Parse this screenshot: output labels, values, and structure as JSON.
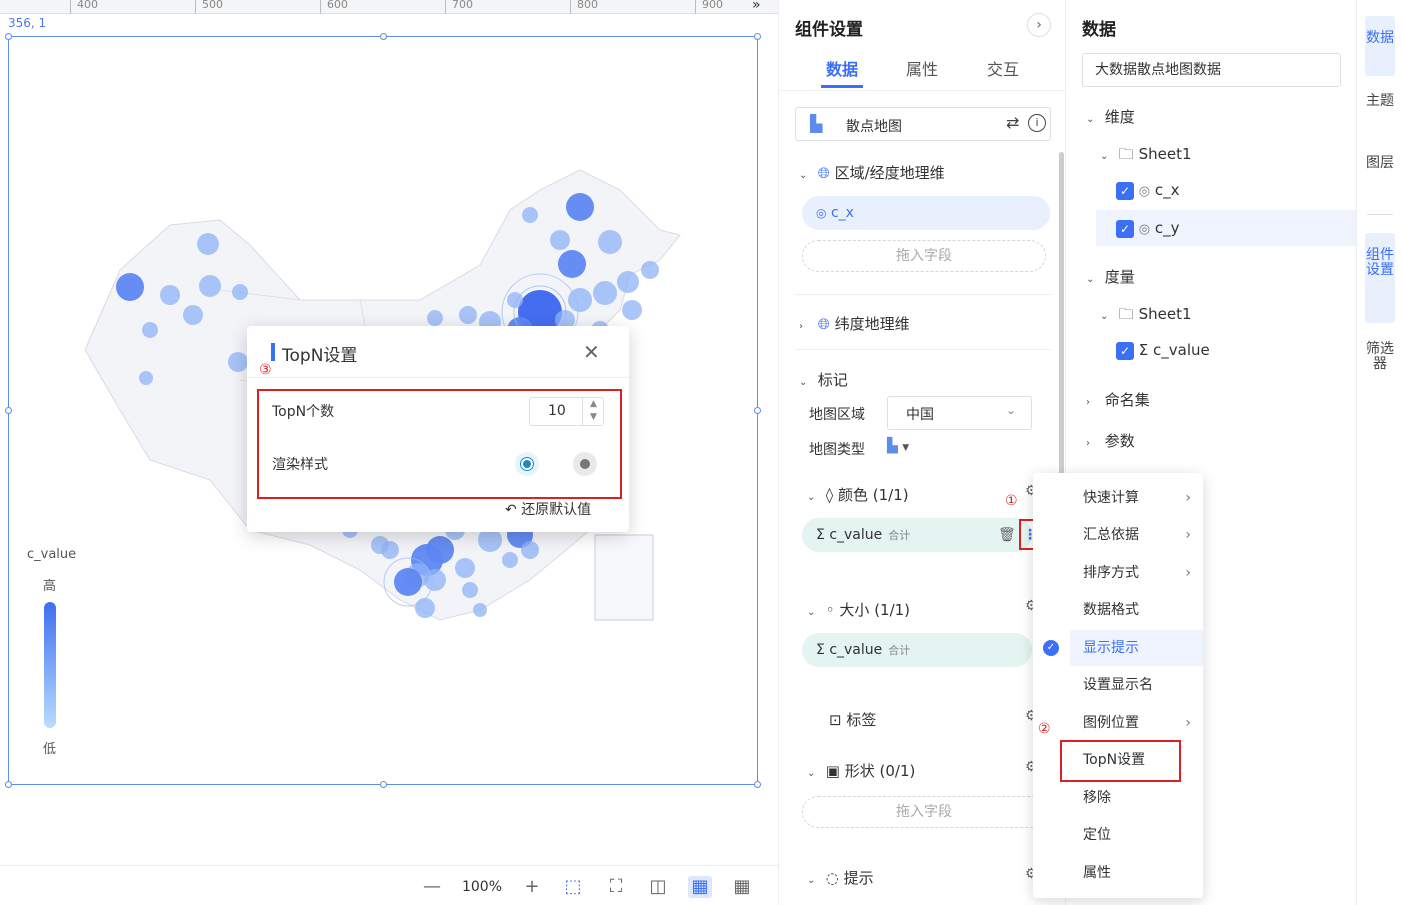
{
  "canvas": {
    "ruler_ticks": [
      "400",
      "500",
      "600",
      "700",
      "800",
      "900"
    ],
    "coord": "356, 1",
    "legend": {
      "title": "c_value",
      "high": "高",
      "low": "低"
    },
    "zoom": {
      "minus": "—",
      "level": "100%",
      "plus": "+"
    }
  },
  "dialog": {
    "title": "TopN设置",
    "annotation": "③",
    "topn_label": "TopN个数",
    "topn_value": "10",
    "render_label": "渲染样式",
    "reset_label": "还原默认值"
  },
  "component_panel": {
    "title": "组件设置",
    "tabs": [
      "数据",
      "属性",
      "交互"
    ],
    "chart_type": "散点地图",
    "region_section": "区域/经度地理维",
    "region_field": "c_x",
    "drop_placeholder": "拖入字段",
    "lat_section": "纬度地理维",
    "mark_section": "标记",
    "map_region_label": "地图区域",
    "map_region_value": "中国",
    "map_type_label": "地图类型",
    "color_section": "颜色 (1/1)",
    "color_field": "c_value",
    "agg_label": "合计",
    "size_section": "大小 (1/1)",
    "size_field": "c_value",
    "label_section": "标签",
    "shape_section": "形状 (0/1)",
    "tooltip_section": "提示",
    "annotation_1": "①",
    "annotation_2": "②"
  },
  "context_menu": {
    "items": [
      {
        "label": "快速计算",
        "submenu": true
      },
      {
        "label": "汇总依据",
        "submenu": true
      },
      {
        "label": "排序方式",
        "submenu": true
      },
      {
        "label": "数据格式",
        "submenu": false
      },
      {
        "label": "显示提示",
        "submenu": false,
        "checked": true
      },
      {
        "label": "设置显示名",
        "submenu": false
      },
      {
        "label": "图例位置",
        "submenu": true
      },
      {
        "label": "TopN设置",
        "submenu": false
      },
      {
        "label": "移除",
        "submenu": false
      },
      {
        "label": "定位",
        "submenu": false
      },
      {
        "label": "属性",
        "submenu": false
      }
    ]
  },
  "data_panel": {
    "title": "数据",
    "dataset": "大数据散点地图数据",
    "dimension_label": "维度",
    "dim_sheet": "Sheet1",
    "dim_fields": [
      "c_x",
      "c_y"
    ],
    "measure_label": "度量",
    "measure_sheet": "Sheet1",
    "measure_fields": [
      "c_value"
    ],
    "named_sets": "命名集",
    "params": "参数"
  },
  "rail": {
    "items": [
      "数据",
      "主题",
      "图层",
      "组件设置",
      "筛选器"
    ]
  },
  "colors": {
    "accent": "#3b6ff5",
    "highlight_red": "#e02020"
  }
}
